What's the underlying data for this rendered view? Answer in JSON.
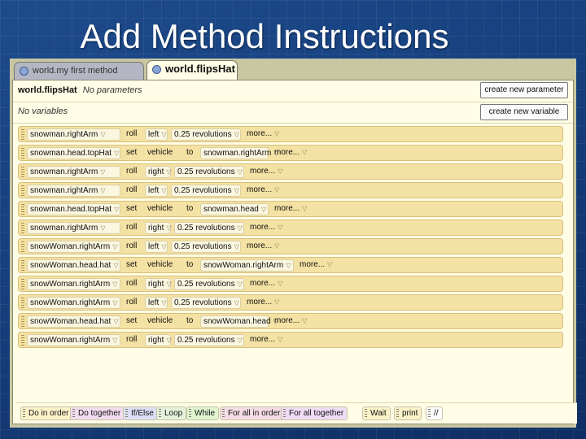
{
  "slide": {
    "title": "Add Method Instructions"
  },
  "tabs": [
    {
      "label": "world.my first method",
      "active": false
    },
    {
      "label": "world.flipsHat",
      "active": true
    }
  ],
  "method_header": {
    "name": "world.flipsHat",
    "params_label": "No parameters",
    "variables_label": "No variables",
    "create_param_label": "create new parameter",
    "create_var_label": "create new variable"
  },
  "statements": [
    {
      "object": "snowman.rightArm",
      "verb": "roll",
      "arg": "left",
      "amount": "0.25 revolutions",
      "more": "more..."
    },
    {
      "object": "snowman.head.topHat",
      "verb": "set",
      "arg": "vehicle",
      "to": "to",
      "amount": "snowman.rightArm",
      "more": "more..."
    },
    {
      "object": "snowman.rightArm",
      "verb": "roll",
      "arg": "right",
      "amount": "0.25 revolutions",
      "more": "more..."
    },
    {
      "object": "snowman.rightArm",
      "verb": "roll",
      "arg": "left",
      "amount": "0.25 revolutions",
      "more": "more..."
    },
    {
      "object": "snowman.head.topHat",
      "verb": "set",
      "arg": "vehicle",
      "to": "to",
      "amount": "snowman.head",
      "more": "more..."
    },
    {
      "object": "snowman.rightArm",
      "verb": "roll",
      "arg": "right",
      "amount": "0.25 revolutions",
      "more": "more..."
    },
    {
      "object": "snowWoman.rightArm",
      "verb": "roll",
      "arg": "left",
      "amount": "0.25 revolutions",
      "more": "more..."
    },
    {
      "object": "snowWoman.head.hat",
      "verb": "set",
      "arg": "vehicle",
      "to": "to",
      "amount": "snowWoman.rightArm",
      "more": "more..."
    },
    {
      "object": "snowWoman.rightArm",
      "verb": "roll",
      "arg": "right",
      "amount": "0.25 revolutions",
      "more": "more..."
    },
    {
      "object": "snowWoman.rightArm",
      "verb": "roll",
      "arg": "left",
      "amount": "0.25 revolutions",
      "more": "more..."
    },
    {
      "object": "snowWoman.head.hat",
      "verb": "set",
      "arg": "vehicle",
      "to": "to",
      "amount": "snowWoman.head",
      "more": "more..."
    },
    {
      "object": "snowWoman.rightArm",
      "verb": "roll",
      "arg": "right",
      "amount": "0.25 revolutions",
      "more": "more..."
    }
  ],
  "controls": [
    {
      "label": "Do in order",
      "color": "#fbf2c8"
    },
    {
      "label": "Do together",
      "color": "#f3dcef"
    },
    {
      "label": "If/Else",
      "color": "#dcdff5"
    },
    {
      "label": "Loop",
      "color": "#e5f3dd"
    },
    {
      "label": "While",
      "color": "#dff5d0"
    },
    {
      "label": "For all in order",
      "color": "#f5dce4"
    },
    {
      "label": "For all together",
      "color": "#f0dcf4"
    },
    {
      "label": "Wait",
      "color": "#fbf2c8"
    },
    {
      "label": "print",
      "color": "#fbf2c8"
    },
    {
      "label": "//",
      "color": "#fbfbfb"
    }
  ],
  "colors": {
    "background": "#1d4b8c",
    "editor_panel": "#fffde6",
    "statement_tile": "#f4e2a4"
  }
}
